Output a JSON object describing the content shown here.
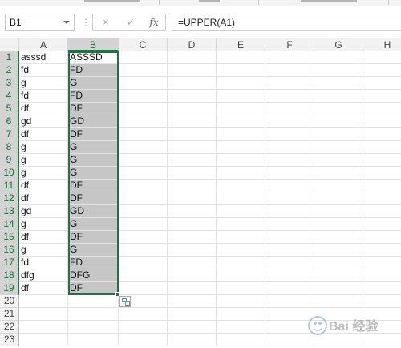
{
  "formula_bar": {
    "name_box": "B1",
    "dots": "⋮",
    "cancel": "×",
    "enter": "✓",
    "fx": "fx",
    "formula": "=UPPER(A1)"
  },
  "columns": [
    "A",
    "B",
    "C",
    "D",
    "E",
    "F",
    "G",
    "H"
  ],
  "rows": [
    "1",
    "2",
    "3",
    "4",
    "5",
    "6",
    "7",
    "8",
    "9",
    "10",
    "11",
    "12",
    "13",
    "14",
    "15",
    "16",
    "17",
    "18",
    "19",
    "20",
    "21",
    "22",
    "23"
  ],
  "column_a": [
    "asssd",
    "fd",
    "g",
    "fd",
    "df",
    "gd",
    "df",
    "g",
    "g",
    "g",
    "df",
    "df",
    "gd",
    "g",
    "df",
    "g",
    "fd",
    "dfg",
    "df"
  ],
  "column_b": [
    "ASSSD",
    "FD",
    "G",
    "FD",
    "DF",
    "GD",
    "DF",
    "G",
    "G",
    "G",
    "DF",
    "DF",
    "GD",
    "G",
    "DF",
    "G",
    "FD",
    "DFG",
    "DF"
  ],
  "selection": {
    "range": "B1:B19",
    "active_column": "B",
    "accent_color": "#217346",
    "fill_color": "#c6c6c6"
  },
  "watermark": {
    "text": "Bai 经验"
  }
}
